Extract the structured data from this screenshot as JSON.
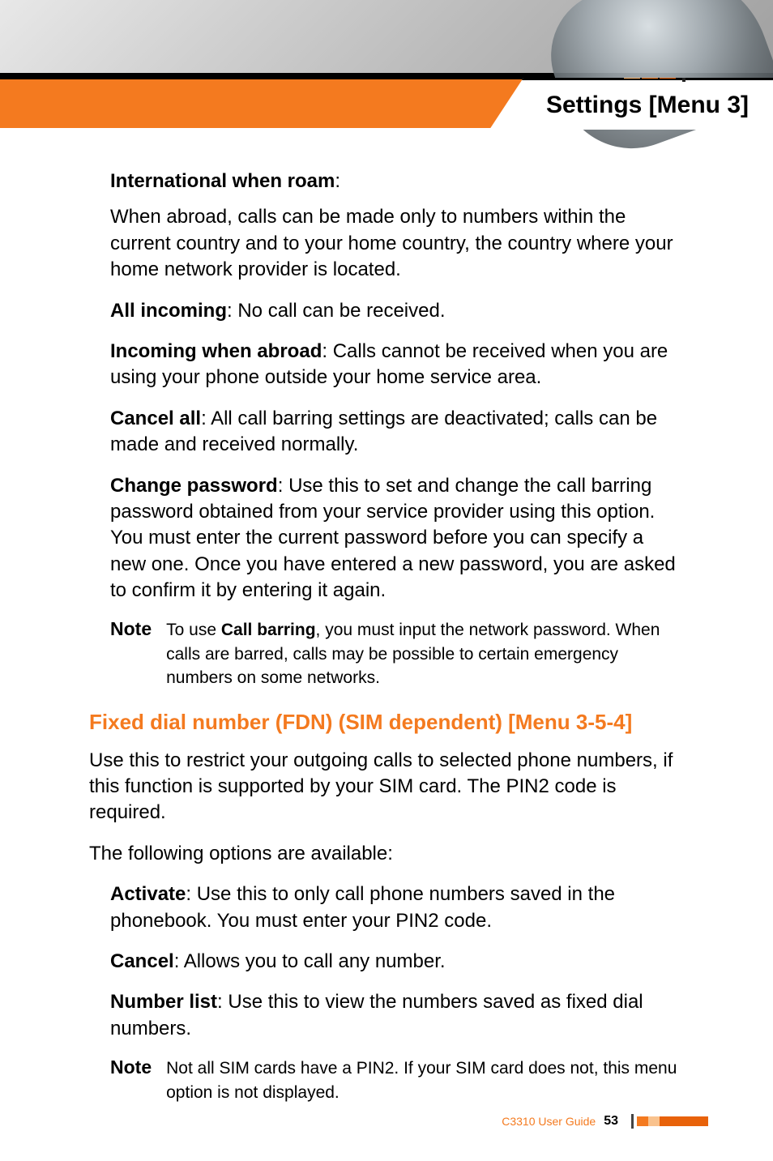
{
  "header": {
    "title": "Settings [Menu 3]"
  },
  "items": [
    {
      "label": "International when roam",
      "suffix": ":",
      "desc": "When abroad, calls can be made only to numbers within the current country and to your home country, the country where your home network provider is located."
    },
    {
      "label": "All incoming",
      "suffix": ": ",
      "desc": "No call can be received."
    },
    {
      "label": "Incoming when abroad",
      "suffix": ": ",
      "desc": "Calls cannot be received when you are using your phone outside your home service area."
    },
    {
      "label": "Cancel all",
      "suffix": ": ",
      "desc": "All call barring settings are deactivated; calls can be made and received normally."
    },
    {
      "label": "Change password",
      "suffix": ": ",
      "desc": "Use this to set and change the call barring password obtained from your service provider using this option. You must enter the current password before you can specify a new one. Once you have entered a new password, you are asked to confirm it by entering it again."
    }
  ],
  "note1": {
    "label": "Note",
    "pre": "To use ",
    "bold": "Call barring",
    "post": ", you must input the network password. When calls are barred, calls may be possible to certain emergency numbers on some networks."
  },
  "section": {
    "title": "Fixed dial number (FDN) (SIM dependent) [Menu 3-5-4]",
    "p1": "Use this to restrict your outgoing calls to selected phone numbers, if this function is supported by your SIM card. The PIN2 code is required.",
    "p2": "The following options are available:"
  },
  "options": [
    {
      "label": "Activate",
      "suffix": ": ",
      "desc": "Use this to only call phone numbers saved in the phonebook. You must enter your PIN2 code."
    },
    {
      "label": "Cancel",
      "suffix": ": ",
      "desc": "Allows you to call any number."
    },
    {
      "label": "Number list",
      "suffix": ": ",
      "desc": "Use this to view the numbers saved as fixed dial numbers."
    }
  ],
  "note2": {
    "label": "Note",
    "text": "Not all SIM cards have a PIN2. If your SIM card does not, this menu option is not displayed."
  },
  "footer": {
    "guide": "C3310 User Guide",
    "page": "53"
  }
}
